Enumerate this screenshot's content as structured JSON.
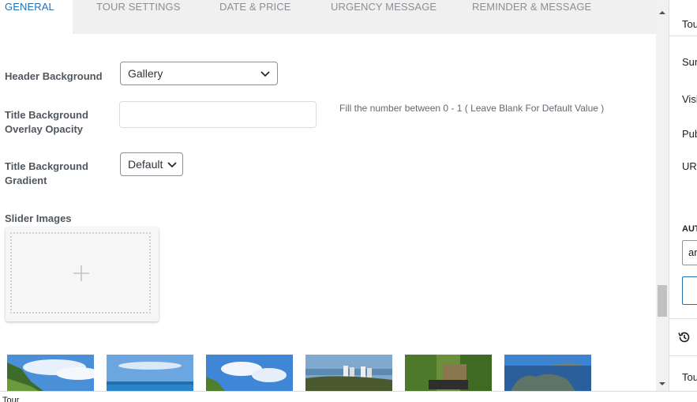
{
  "tabs": [
    {
      "label": "GENERAL"
    },
    {
      "label": "TOUR SETTINGS"
    },
    {
      "label": "DATE & PRICE"
    },
    {
      "label": "URGENCY MESSAGE"
    },
    {
      "label": "REMINDER & MESSAGE"
    }
  ],
  "form": {
    "header_background": {
      "label": "Header Background",
      "value": "Gallery"
    },
    "title_opacity": {
      "label_line1": "Title Background",
      "label_line2": "Overlay Opacity",
      "value": "",
      "help": "Fill the number between 0 - 1 ( Leave Blank For Default Value )"
    },
    "title_gradient": {
      "label_line1": "Title Background",
      "label_line2": "Gradient",
      "value": "Default"
    },
    "slider_images": {
      "label": "Slider Images"
    }
  },
  "gallery": {
    "thumbnails": [
      {
        "icon": "landscape-cliff-sky"
      },
      {
        "icon": "landscape-sea-sky"
      },
      {
        "icon": "landscape-tree-sky"
      },
      {
        "icon": "landscape-city-hill"
      },
      {
        "icon": "landscape-forest-vehicle"
      },
      {
        "icon": "landscape-island-sea"
      }
    ]
  },
  "sidebar": {
    "tab": "Tou",
    "summary": "Sur",
    "visibility": "Visi",
    "publish": "Pub",
    "url": "URI",
    "author_label": "AUT",
    "author_value": "ar",
    "revisions_icon": "history-icon",
    "tour_section": "Tou"
  },
  "footer": {
    "text": "Tour"
  }
}
